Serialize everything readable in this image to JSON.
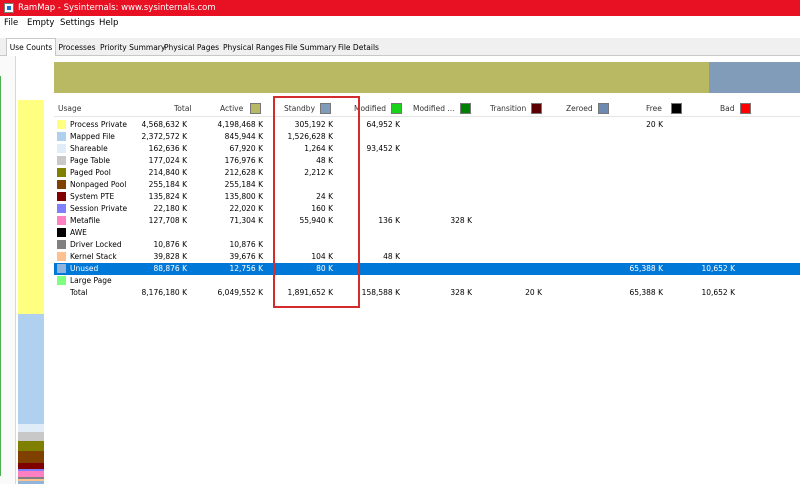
{
  "window": {
    "title": "RamMap - Sysinternals: www.sysinternals.com"
  },
  "menu": [
    "File",
    "Empty",
    "Settings",
    "Help"
  ],
  "tabs": [
    "Use Counts",
    "Processes",
    "Priority Summary",
    "Physical Pages",
    "Physical Ranges",
    "File Summary",
    "File Details"
  ],
  "active_tab": "Use Counts",
  "columns": [
    {
      "label": "Usage"
    },
    {
      "label": "Total"
    },
    {
      "label": "Active",
      "color": "#b9b963"
    },
    {
      "label": "Standby",
      "color": "#809cb8"
    },
    {
      "label": "Modified",
      "color": "#19d319"
    },
    {
      "label": "Modified ...",
      "color": "#008000"
    },
    {
      "label": "Transition",
      "color": "#5a0000"
    },
    {
      "label": "Zeroed",
      "color": "#6d8ab0"
    },
    {
      "label": "Free",
      "color": "#000000"
    },
    {
      "label": "Bad",
      "color": "#ff0000"
    }
  ],
  "rows": [
    {
      "usage": "Process Private",
      "color": "#ffff80",
      "values": [
        "4,568,632 K",
        "4,198,468 K",
        "305,192 K",
        "64,952 K",
        "",
        "",
        "20 K",
        "",
        ""
      ]
    },
    {
      "usage": "Mapped File",
      "color": "#b0d0f0",
      "values": [
        "2,372,572 K",
        "845,944 K",
        "1,526,628 K",
        "",
        "",
        "",
        "",
        "",
        ""
      ]
    },
    {
      "usage": "Shareable",
      "color": "#e0ecf8",
      "values": [
        "162,636 K",
        "67,920 K",
        "1,264 K",
        "93,452 K",
        "",
        "",
        "",
        "",
        ""
      ]
    },
    {
      "usage": "Page Table",
      "color": "#c8c8c8",
      "values": [
        "177,024 K",
        "176,976 K",
        "48 K",
        "",
        "",
        "",
        "",
        "",
        ""
      ]
    },
    {
      "usage": "Paged Pool",
      "color": "#808000",
      "values": [
        "214,840 K",
        "212,628 K",
        "2,212 K",
        "",
        "",
        "",
        "",
        "",
        ""
      ]
    },
    {
      "usage": "Nonpaged Pool",
      "color": "#804000",
      "values": [
        "255,184 K",
        "255,184 K",
        "",
        "",
        "",
        "",
        "",
        "",
        ""
      ]
    },
    {
      "usage": "System PTE",
      "color": "#800000",
      "values": [
        "135,824 K",
        "135,800 K",
        "24 K",
        "",
        "",
        "",
        "",
        "",
        ""
      ]
    },
    {
      "usage": "Session Private",
      "color": "#8080ff",
      "values": [
        "22,180 K",
        "22,020 K",
        "160 K",
        "",
        "",
        "",
        "",
        "",
        ""
      ]
    },
    {
      "usage": "Metafile",
      "color": "#ff80c0",
      "values": [
        "127,708 K",
        "71,304 K",
        "55,940 K",
        "136 K",
        "328 K",
        "",
        "",
        "",
        ""
      ]
    },
    {
      "usage": "AWE",
      "color": "#000000",
      "values": [
        "",
        "",
        "",
        "",
        "",
        "",
        "",
        "",
        ""
      ]
    },
    {
      "usage": "Driver Locked",
      "color": "#808080",
      "values": [
        "10,876 K",
        "10,876 K",
        "",
        "",
        "",
        "",
        "",
        "",
        ""
      ]
    },
    {
      "usage": "Kernel Stack",
      "color": "#ffc090",
      "values": [
        "39,828 K",
        "39,676 K",
        "104 K",
        "48 K",
        "",
        "",
        "",
        "",
        ""
      ]
    },
    {
      "usage": "Unused",
      "color": "#90b4dc",
      "values": [
        "88,876 K",
        "12,756 K",
        "80 K",
        "",
        "",
        "",
        "65,388 K",
        "10,652 K",
        ""
      ],
      "selected": true
    },
    {
      "usage": "Large Page",
      "color": "#80ff80",
      "values": [
        "",
        "",
        "",
        "",
        "",
        "",
        "",
        "",
        ""
      ]
    },
    {
      "usage": "Total",
      "color": "",
      "values": [
        "8,176,180 K",
        "6,049,552 K",
        "1,891,652 K",
        "158,588 K",
        "328 K",
        "20 K",
        "65,388 K",
        "10,652 K",
        ""
      ]
    }
  ],
  "colors": {
    "titlebar": "#e81123",
    "selection": "#0078d7",
    "highlight_box": "#d42c2c",
    "active_bar": "#b9b963",
    "zeroed_bar": "#809cb8"
  }
}
